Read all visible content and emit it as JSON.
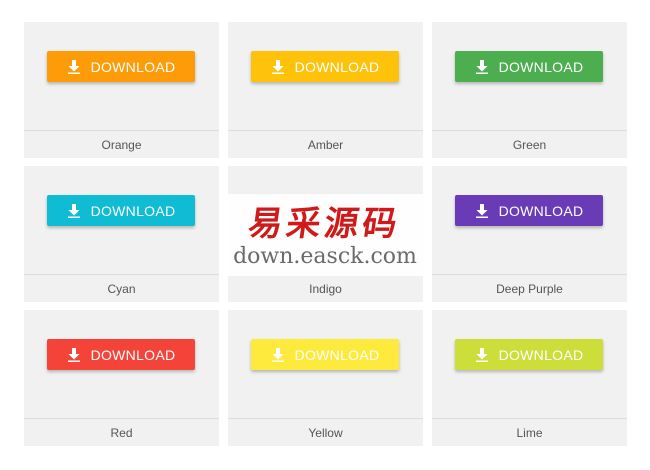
{
  "cards": [
    {
      "button_label": "DOWNLOAD",
      "button_color": "#fe9b08",
      "text_color": "#ffffff",
      "icon": "download-icon",
      "name": "Orange"
    },
    {
      "button_label": "DOWNLOAD",
      "button_color": "#fec20b",
      "text_color": "#ffffff",
      "icon": "download-icon",
      "name": "Amber"
    },
    {
      "button_label": "DOWNLOAD",
      "button_color": "#4cae4f",
      "text_color": "#ffffff",
      "icon": "download-icon",
      "name": "Green"
    },
    {
      "button_label": "DOWNLOAD",
      "button_color": "#10bcd4",
      "text_color": "#ffffff",
      "icon": "download-icon",
      "name": "Cyan"
    },
    {
      "button_label": "",
      "button_color": "",
      "text_color": "#ffffff",
      "icon": "",
      "name": "Indigo"
    },
    {
      "button_label": "DOWNLOAD",
      "button_color": "#6a3bb7",
      "text_color": "#ffffff",
      "icon": "download-icon",
      "name": "Deep Purple"
    },
    {
      "button_label": "DOWNLOAD",
      "button_color": "#f4443a",
      "text_color": "#ffffff",
      "icon": "download-icon",
      "name": "Red"
    },
    {
      "button_label": "DOWNLOAD",
      "button_color": "#feea3c",
      "text_color": "#ffffff",
      "icon": "download-icon",
      "name": "Yellow"
    },
    {
      "button_label": "DOWNLOAD",
      "button_color": "#cddd39",
      "text_color": "#ffffff",
      "icon": "download-icon",
      "name": "Lime"
    }
  ],
  "watermark": {
    "chinese_text": "易采源码",
    "url_text": "down.easck.com",
    "chinese_color": "#d01a1a"
  }
}
